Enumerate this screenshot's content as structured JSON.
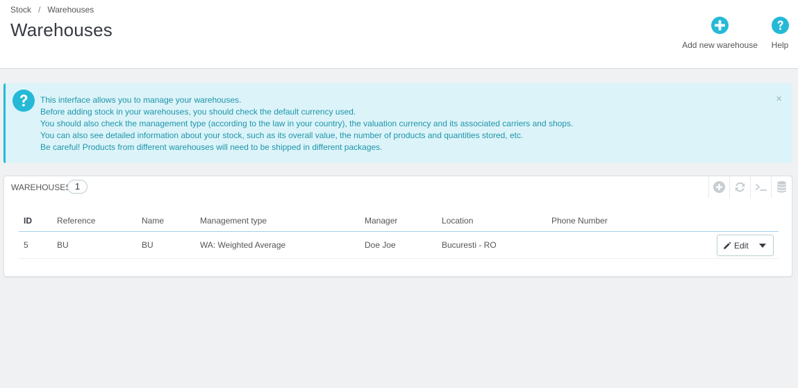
{
  "breadcrumb": {
    "parent": "Stock",
    "separator": "/",
    "current": "Warehouses"
  },
  "page": {
    "title": "Warehouses"
  },
  "toolbar": {
    "add_label": "Add new warehouse",
    "help_label": "Help"
  },
  "colors": {
    "accent": "#25b9d7",
    "alert_bg": "#dcf4f9",
    "alert_text": "#1e94ab"
  },
  "alert": {
    "icon": "question-circle-icon",
    "lines": [
      "This interface allows you to manage your warehouses.",
      "Before adding stock in your warehouses, you should check the default currency used.",
      "You should also check the management type (according to the law in your country), the valuation currency and its associated carriers and shops.",
      "You can also see detailed information about your stock, such as its overall value, the number of products and quantities stored, etc.",
      "Be careful! Products from different warehouses will need to be shipped in different packages."
    ],
    "close": "×"
  },
  "panel": {
    "title": "Warehouses",
    "count": "1",
    "actions": [
      "add-icon",
      "refresh-icon",
      "sql-terminal-icon",
      "database-export-icon"
    ]
  },
  "table": {
    "columns": [
      "ID",
      "Reference",
      "Name",
      "Management type",
      "Manager",
      "Location",
      "Phone Number"
    ],
    "rows": [
      {
        "id": "5",
        "reference": "BU",
        "name": "BU",
        "management_type": "WA: Weighted Average",
        "manager": "Doe Joe",
        "location": "Bucuresti - RO",
        "phone": "",
        "edit_label": "Edit"
      }
    ]
  }
}
